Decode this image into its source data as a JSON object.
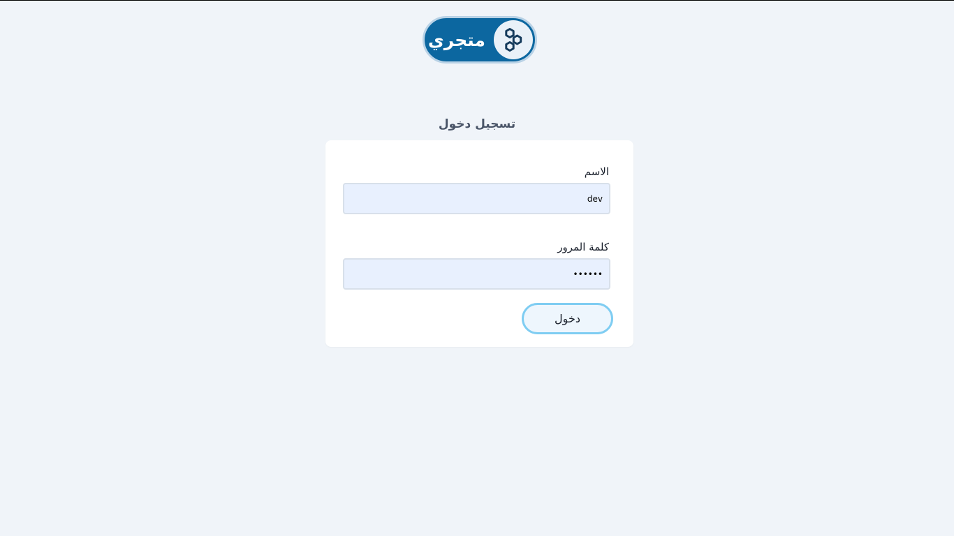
{
  "brand": {
    "name": "متجري",
    "logo_icon": "hexagons-icon",
    "colors": {
      "primary": "#0c67a0",
      "accent": "#7fcdf2"
    }
  },
  "login": {
    "title": "تسجيل دخول",
    "username": {
      "label": "الاسم",
      "value": "dev"
    },
    "password": {
      "label": "كلمة المرور",
      "value": "••••••"
    },
    "submit_label": "دخول"
  }
}
